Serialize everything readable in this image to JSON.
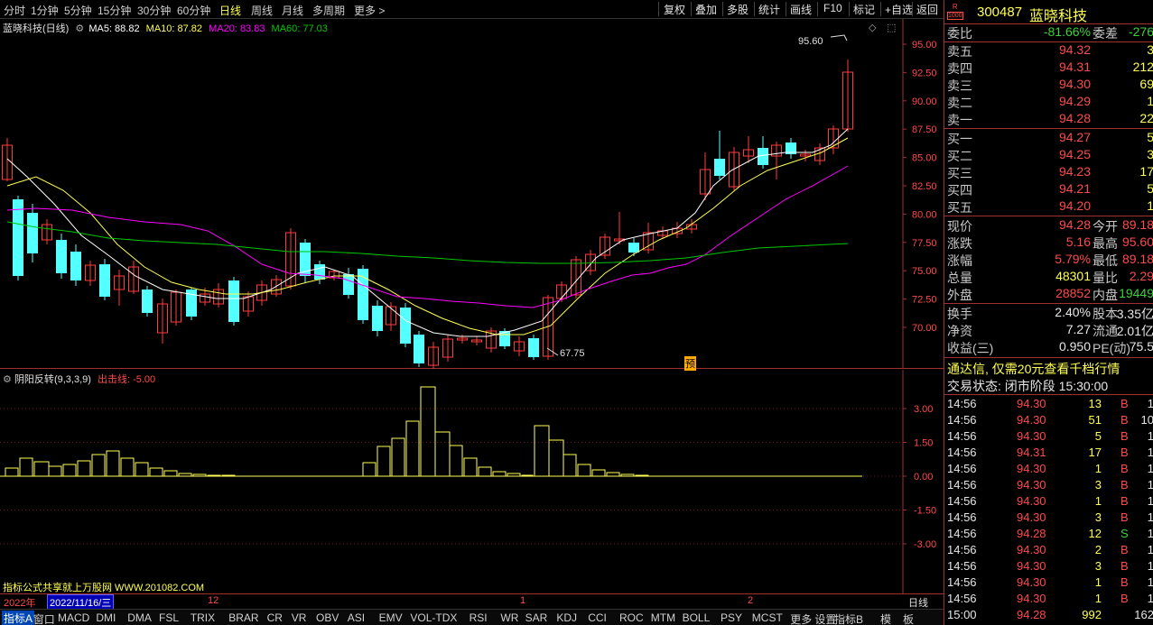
{
  "toolbar": {
    "periods": [
      "分时",
      "1分钟",
      "5分钟",
      "15分钟",
      "30分钟",
      "60分钟",
      "日线",
      "周线",
      "月线",
      "多周期",
      "更多 >"
    ],
    "active_period": "日线",
    "buttons": [
      "复权",
      "叠加",
      "多股",
      "统计",
      "画线",
      "F10",
      "标记",
      "+自选",
      "返回"
    ]
  },
  "main": {
    "stock_label": "蓝晓科技(日线)",
    "ma": [
      {
        "label": "MA5: 88.82",
        "color": "#ffffff"
      },
      {
        "label": "MA10: 87.82",
        "color": "#ffff54"
      },
      {
        "label": "MA20: 83.83",
        "color": "#ff00ff"
      },
      {
        "label": "MA60: 77.03",
        "color": "#00c800"
      }
    ],
    "high_label": "95.60",
    "low_label": "67.75",
    "yu_marker": "预",
    "y_ticks": [
      "95.00",
      "92.50",
      "90.00",
      "87.50",
      "85.00",
      "82.50",
      "80.00",
      "77.50",
      "75.00",
      "72.50",
      "70.00"
    ]
  },
  "indicator": {
    "name": "阴阳反转",
    "params": "(9,3,3,9)",
    "signal_label": "出击线: -5.00",
    "y_ticks": [
      "3.00",
      "1.50",
      "0.00",
      "-1.50",
      "-3.00"
    ]
  },
  "timeaxis": {
    "year": "2022年",
    "date_box": "2022/11/16/三",
    "marks": [
      "12",
      "1",
      "2"
    ],
    "right": "日线"
  },
  "watermark_text": "指标公式共享就上万股网 WWW.201082.COM",
  "tabs": [
    "指标A",
    "窗口",
    "MACD",
    "DMI",
    "DMA",
    "FSL",
    "TRIX",
    "BRAR",
    "CR",
    "VR",
    "OBV",
    "ASI",
    "EMV",
    "VOL-TDX",
    "RSI",
    "WR",
    "SAR",
    "KDJ",
    "CCI",
    "ROC",
    "MTM",
    "BOLL",
    "PSY",
    "MCST",
    "更多",
    "设置"
  ],
  "tabs_right": [
    "指标B",
    "模",
    "板"
  ],
  "quote": {
    "code": "300487",
    "name": "蓝晓科技",
    "rows": [
      {
        "l": "委比",
        "v1": "-81.66%",
        "c1": "green",
        "l2": "委差",
        "v2": "-276",
        "c2": "green"
      }
    ],
    "sells": [
      {
        "l": "卖五",
        "p": "94.32",
        "q": "3"
      },
      {
        "l": "卖四",
        "p": "94.31",
        "q": "212"
      },
      {
        "l": "卖三",
        "p": "94.30",
        "q": "69"
      },
      {
        "l": "卖二",
        "p": "94.29",
        "q": "1"
      },
      {
        "l": "卖一",
        "p": "94.28",
        "q": "22"
      }
    ],
    "buys": [
      {
        "l": "买一",
        "p": "94.27",
        "q": "5"
      },
      {
        "l": "买二",
        "p": "94.25",
        "q": "3"
      },
      {
        "l": "买三",
        "p": "94.23",
        "q": "17"
      },
      {
        "l": "买四",
        "p": "94.21",
        "q": "5"
      },
      {
        "l": "买五",
        "p": "94.20",
        "q": "1"
      }
    ],
    "stats": [
      {
        "l": "现价",
        "v1": "94.28",
        "c1": "red",
        "l2": "今开",
        "v2": "89.18",
        "c2": "red"
      },
      {
        "l": "涨跌",
        "v1": "5.16",
        "c1": "red",
        "l2": "最高",
        "v2": "95.60",
        "c2": "red"
      },
      {
        "l": "涨幅",
        "v1": "5.79%",
        "c1": "red",
        "l2": "最低",
        "v2": "89.18",
        "c2": "red"
      },
      {
        "l": "总量",
        "v1": "48301",
        "c1": "yel",
        "l2": "量比",
        "v2": "2.29",
        "c2": "red"
      },
      {
        "l": "外盘",
        "v1": "28852",
        "c1": "red",
        "l2": "内盘",
        "v2": "19449",
        "c2": "green"
      }
    ],
    "stats2": [
      {
        "l": "换手",
        "v1": "2.40%",
        "c1": "white",
        "l2": "股本",
        "v2": "3.35亿",
        "c2": "white"
      },
      {
        "l": "净资",
        "v1": "7.27",
        "c1": "white",
        "l2": "流通",
        "v2": "2.01亿",
        "c2": "white"
      },
      {
        "l": "收益(三)",
        "v1": "0.950",
        "c1": "white",
        "l2": "PE(动)",
        "v2": "75.5",
        "c2": "white"
      }
    ],
    "promo": "通达信, 仅需20元查看千档行情",
    "status": "交易状态: 闭市阶段 15:30:00",
    "ticks": [
      {
        "t": "14:56",
        "p": "94.30",
        "v": "13",
        "s": "B",
        "x": "1"
      },
      {
        "t": "14:56",
        "p": "94.30",
        "v": "51",
        "s": "B",
        "x": "10"
      },
      {
        "t": "14:56",
        "p": "94.30",
        "v": "5",
        "s": "B",
        "x": "1"
      },
      {
        "t": "14:56",
        "p": "94.31",
        "v": "17",
        "s": "B",
        "x": "1"
      },
      {
        "t": "14:56",
        "p": "94.30",
        "v": "1",
        "s": "B",
        "x": "1"
      },
      {
        "t": "14:56",
        "p": "94.30",
        "v": "3",
        "s": "B",
        "x": "1"
      },
      {
        "t": "14:56",
        "p": "94.30",
        "v": "1",
        "s": "B",
        "x": "1"
      },
      {
        "t": "14:56",
        "p": "94.30",
        "v": "3",
        "s": "B",
        "x": "1"
      },
      {
        "t": "14:56",
        "p": "94.28",
        "v": "12",
        "s": "S",
        "x": "1"
      },
      {
        "t": "14:56",
        "p": "94.30",
        "v": "2",
        "s": "B",
        "x": "1"
      },
      {
        "t": "14:56",
        "p": "94.30",
        "v": "3",
        "s": "B",
        "x": "1"
      },
      {
        "t": "14:56",
        "p": "94.30",
        "v": "1",
        "s": "B",
        "x": "1"
      },
      {
        "t": "14:56",
        "p": "94.30",
        "v": "1",
        "s": "B",
        "x": "1"
      },
      {
        "t": "15:00",
        "p": "94.28",
        "v": "992",
        "s": "",
        "x": "162"
      }
    ]
  },
  "colors": {
    "up": "#ff3c3c",
    "down": "#54ffff",
    "axis": "#a03030",
    "bg": "#000000"
  }
}
